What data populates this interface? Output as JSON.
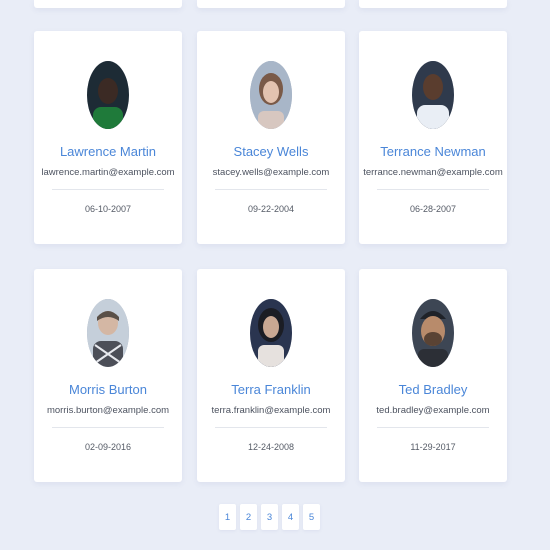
{
  "users": [
    {
      "name": "Lawrence Martin",
      "email": "lawrence.martin@example.com",
      "date": "06-10-2007",
      "avatar_colors": [
        "#1d2b35",
        "#3b2a24",
        "#1f7a3a"
      ]
    },
    {
      "name": "Stacey Wells",
      "email": "stacey.wells@example.com",
      "date": "09-22-2004",
      "avatar_colors": [
        "#a8b6c8",
        "#7a5a48",
        "#e3c3b0"
      ]
    },
    {
      "name": "Terrance Newman",
      "email": "terrance.newman@example.com",
      "date": "06-28-2007",
      "avatar_colors": [
        "#2f3a4c",
        "#5a3d2e",
        "#e9eef5"
      ]
    },
    {
      "name": "Morris Burton",
      "email": "morris.burton@example.com",
      "date": "02-09-2016",
      "avatar_colors": [
        "#c5cfda",
        "#d4b7a4",
        "#4c4f58"
      ]
    },
    {
      "name": "Terra Franklin",
      "email": "terra.franklin@example.com",
      "date": "12-24-2008",
      "avatar_colors": [
        "#2a3550",
        "#c9a893",
        "#1b1d24"
      ]
    },
    {
      "name": "Ted Bradley",
      "email": "ted.bradley@example.com",
      "date": "11-29-2017",
      "avatar_colors": [
        "#3d4654",
        "#b88b6b",
        "#2c2f36"
      ]
    }
  ],
  "pagination": [
    "1",
    "2",
    "3",
    "4",
    "5"
  ]
}
